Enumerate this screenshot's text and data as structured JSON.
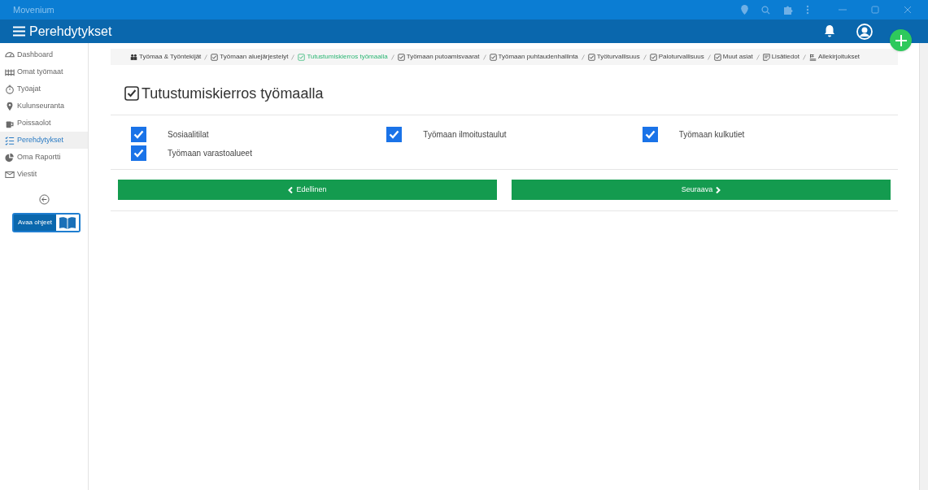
{
  "window": {
    "title": "Movenium"
  },
  "header": {
    "title": "Perehdytykset"
  },
  "sidebar": {
    "items": [
      {
        "label": "Dashboard",
        "kind": "gauge",
        "selected": false
      },
      {
        "label": "Omat työmaat",
        "kind": "site",
        "selected": false
      },
      {
        "label": "Työajat",
        "kind": "timer",
        "selected": false
      },
      {
        "label": "Kulunseuranta",
        "kind": "pin",
        "selected": false
      },
      {
        "label": "Poissaolot",
        "kind": "mug",
        "selected": false
      },
      {
        "label": "Perehdytykset",
        "kind": "list",
        "selected": true
      },
      {
        "label": "Oma Raportti",
        "kind": "pie",
        "selected": false
      },
      {
        "label": "Viestit",
        "kind": "mail",
        "selected": false
      }
    ],
    "help_button": "Avaa ohjeet"
  },
  "breadcrumb": [
    {
      "label": "Työmaa & Työntekijät",
      "kind": "people",
      "selected": false
    },
    {
      "label": "Työmaan aluejärjestelyt",
      "kind": "check",
      "selected": false
    },
    {
      "label": "Tutustumiskierros työmaalla",
      "kind": "check",
      "selected": true
    },
    {
      "label": "Työmaan putoamisvaarat",
      "kind": "check",
      "selected": false
    },
    {
      "label": "Työmaan puhtaudenhallinta",
      "kind": "check",
      "selected": false
    },
    {
      "label": "Työturvallisuus",
      "kind": "check",
      "selected": false
    },
    {
      "label": "Paloturvallisuus",
      "kind": "check",
      "selected": false
    },
    {
      "label": "Muut asiat",
      "kind": "check",
      "selected": false
    },
    {
      "label": "Lisätiedot",
      "kind": "note",
      "selected": false
    },
    {
      "label": "Allekirjoitukset",
      "kind": "sign",
      "selected": false
    }
  ],
  "page_title": "Tutustumiskierros työmaalla",
  "checklist": [
    {
      "label": "Sosiaalitilat",
      "checked": true
    },
    {
      "label": "Työmaan ilmoitustaulut",
      "checked": true
    },
    {
      "label": "Työmaan kulkutiet",
      "checked": true
    },
    {
      "label": "Työmaan varastoalueet",
      "checked": true
    }
  ],
  "buttons": {
    "previous": "Edellinen",
    "next": "Seuraava"
  }
}
